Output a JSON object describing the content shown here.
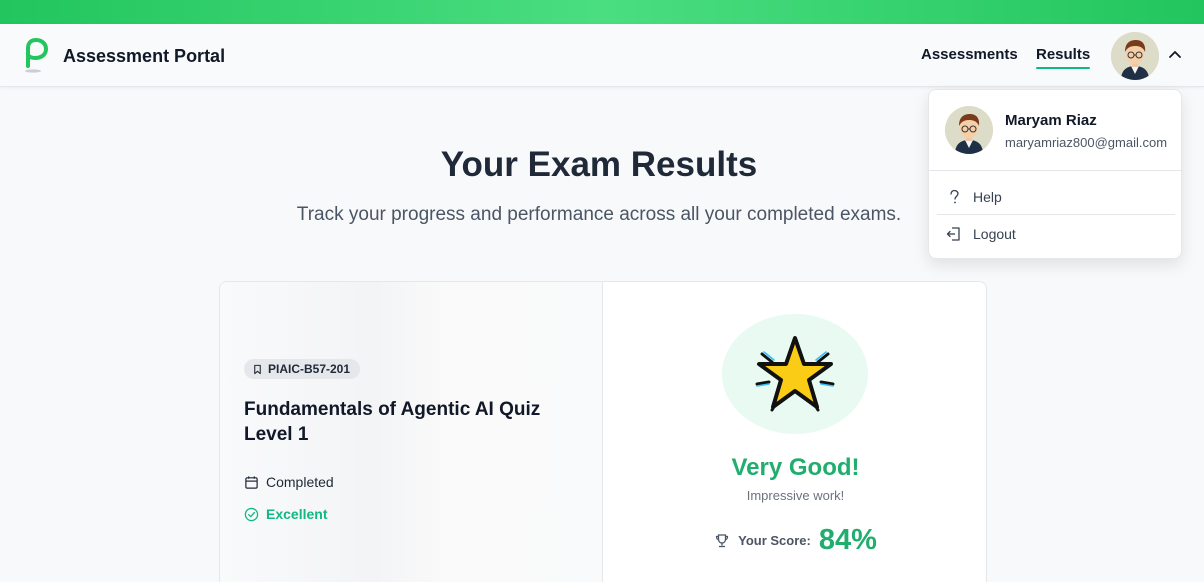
{
  "header": {
    "app_title": "Assessment Portal",
    "nav": {
      "assessments": "Assessments",
      "results": "Results"
    },
    "active_nav": "Results",
    "accent_color": "#10b981",
    "topbar_color": "#22c55e"
  },
  "main": {
    "title": "Your Exam Results",
    "subtitle": "Track your progress and performance across all your completed exams."
  },
  "result_card": {
    "badge": "PIAIC-B57-201",
    "quiz_title": "Fundamentals of Agentic AI Quiz Level 1",
    "status": "Completed",
    "grade": "Excellent",
    "verdict": "Very Good!",
    "verdict_sub": "Impressive work!",
    "score_label": "Your Score:",
    "score_value": "84%",
    "icons": {
      "badge": "bookmark-icon",
      "status": "calendar-icon",
      "grade": "check-circle-icon",
      "score": "trophy-icon",
      "hero": "star-icon"
    }
  },
  "user_menu": {
    "name": "Maryam Riaz",
    "email": "maryamriaz800@gmail.com",
    "items": [
      {
        "label": "Help",
        "icon": "question-icon"
      },
      {
        "label": "Logout",
        "icon": "logout-icon"
      }
    ]
  }
}
